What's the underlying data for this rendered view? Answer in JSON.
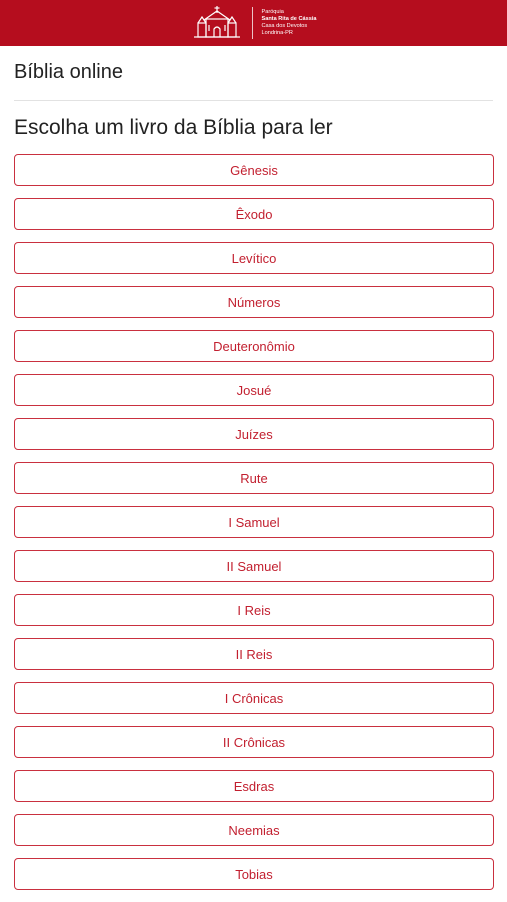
{
  "header": {
    "logo": {
      "lines": [
        "Paróquia",
        "Santa Rita de Cássia",
        "Casa dos Devotos",
        "Londrina-PR"
      ],
      "icon": "church-icon"
    },
    "colors": {
      "brand": "#b50d1e",
      "accent": "#c21f2f"
    }
  },
  "page": {
    "title": "Bíblia online",
    "subtitle": "Escolha um livro da Bíblia para ler"
  },
  "books": [
    "Gênesis",
    "Êxodo",
    "Levítico",
    "Números",
    "Deuteronômio",
    "Josué",
    "Juízes",
    "Rute",
    "I Samuel",
    "II Samuel",
    "I Reis",
    "II Reis",
    "I Crônicas",
    "II Crônicas",
    "Esdras",
    "Neemias",
    "Tobias"
  ]
}
